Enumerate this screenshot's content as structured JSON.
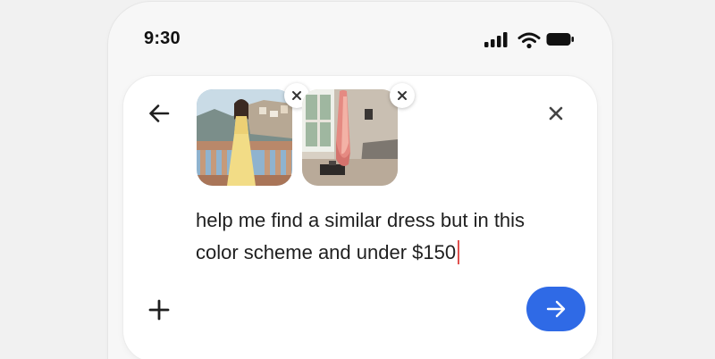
{
  "status_bar": {
    "time": "9:30",
    "icons": [
      "signal-icon",
      "wifi-icon",
      "battery-icon"
    ]
  },
  "composer": {
    "back_icon": "arrow-left-icon",
    "close_icon": "close-icon",
    "attachments": [
      {
        "name": "woman-yellow-dress-photo",
        "remove_icon": "close-icon"
      },
      {
        "name": "room-pink-scarf-photo",
        "remove_icon": "close-icon"
      }
    ],
    "prompt_text": "help me find a similar dress but in this color scheme and under $150",
    "add_icon": "plus-icon",
    "send_icon": "arrow-right-icon",
    "colors": {
      "send_button": "#2f6ae6",
      "caret": "#e0514e",
      "text": "#1f1f1f"
    }
  }
}
